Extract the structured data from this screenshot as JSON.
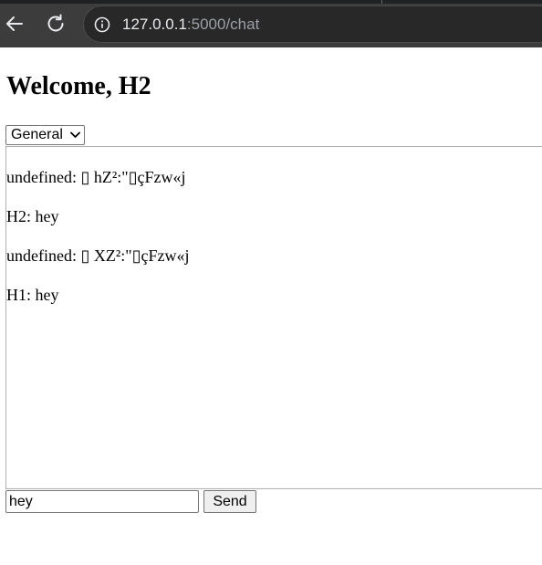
{
  "browser": {
    "url_host": "127.0.0.1",
    "url_rest": ":5000/chat",
    "back_icon": "arrow-left",
    "reload_icon": "reload",
    "site_info_icon": "info-circle"
  },
  "page": {
    "heading": "Welcome, H2",
    "room_select": {
      "selected": "General"
    },
    "messages": [
      {
        "text": "undefined: ▯ hZ²:\"▯çFzw«j"
      },
      {
        "text": "H2: hey"
      },
      {
        "text": "undefined: ▯ XZ²:\"▯çFzw«j"
      },
      {
        "text": "H1: hey"
      }
    ],
    "composer": {
      "input_value": "hey",
      "send_label": "Send"
    }
  },
  "colors": {
    "chrome_bg": "#3c3c3c",
    "omnibox_bg": "#282828",
    "url_host": "#e8eaed",
    "url_rest": "#9aa0a6"
  }
}
